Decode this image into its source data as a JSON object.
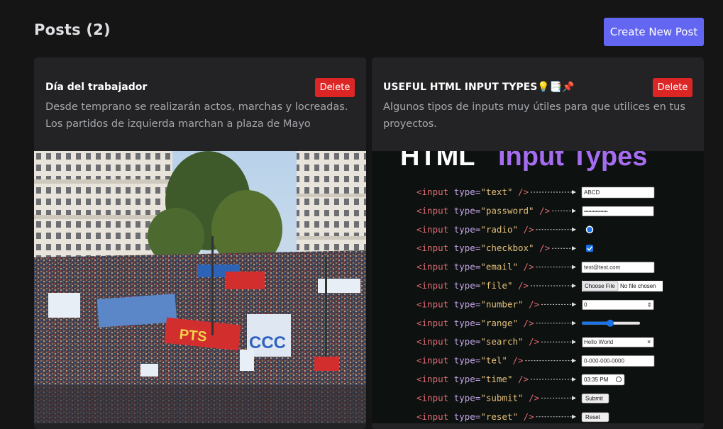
{
  "header": {
    "title": "Posts (2)",
    "create_label": "Create New Post"
  },
  "posts": [
    {
      "title": "Día del trabajador",
      "body": "Desde temprano se realizarán actos, marchas y locreadas. Los partidos de izquierda marchan a plaza de Mayo",
      "delete_label": "Delete",
      "image": {
        "kind": "photo",
        "banner_text": "CCC",
        "flag_text": "PTS"
      }
    },
    {
      "title": "USEFUL HTML INPUT TYPES💡📑📌",
      "body": "Algunos tipos de inputs muy útiles para que utilices en tus proyectos.",
      "delete_label": "Delete",
      "image": {
        "kind": "infographic",
        "heading_white": "HTML",
        "heading_purple": "Input Types",
        "rows": [
          {
            "type": "text",
            "demo": "ABCD"
          },
          {
            "type": "password",
            "demo": "••••••••••••••••"
          },
          {
            "type": "radio",
            "demo": ""
          },
          {
            "type": "checkbox",
            "demo": ""
          },
          {
            "type": "email",
            "demo": "test@test.com"
          },
          {
            "type": "file",
            "demo": "Choose File",
            "demo2": "No file chosen"
          },
          {
            "type": "number",
            "demo": "0"
          },
          {
            "type": "range",
            "demo": ""
          },
          {
            "type": "search",
            "demo": "Hello World"
          },
          {
            "type": "tel",
            "demo": "0-000-000-0000"
          },
          {
            "type": "time",
            "demo": "03:35 PM"
          },
          {
            "type": "submit",
            "demo": "Submit"
          },
          {
            "type": "reset",
            "demo": "Reset"
          }
        ]
      }
    }
  ],
  "colors": {
    "accent": "#6366f1",
    "danger": "#dc2626",
    "card_bg": "#232325",
    "page_bg": "#151516",
    "code_tag": "#e06c75",
    "code_attr": "#c5a5e8",
    "code_value": "#e5c07b",
    "heading_purple": "#a56cf0"
  }
}
